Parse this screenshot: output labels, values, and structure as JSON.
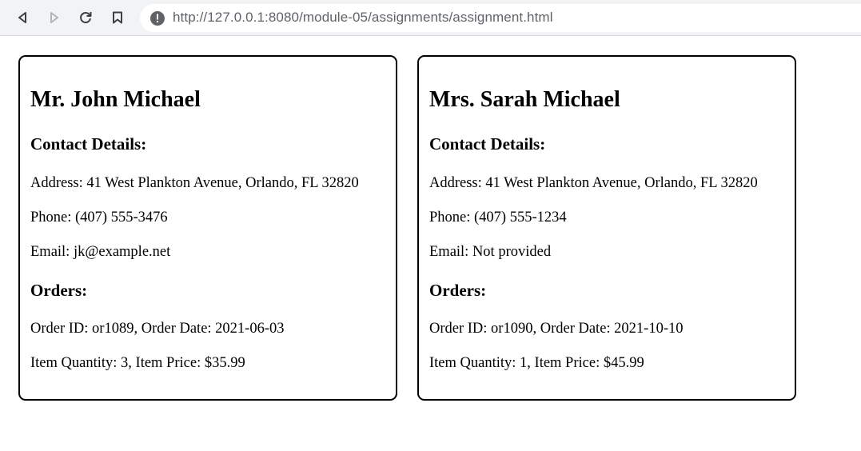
{
  "browser": {
    "url": "http://127.0.0.1:8080/module-05/assignments/assignment.html",
    "buttons": {
      "back": "back-arrow-icon",
      "forward": "forward-arrow-icon",
      "reload": "reload-icon",
      "bookmark": "bookmark-icon"
    },
    "info_icon": "info-icon"
  },
  "customers": [
    {
      "name": "Mr. John Michael",
      "contact_heading": "Contact Details:",
      "address": "Address: 41 West Plankton Avenue, Orlando, FL 32820",
      "phone": "Phone: (407) 555-3476",
      "email": "Email: jk@example.net",
      "orders_heading": "Orders:",
      "order": "Order ID: or1089, Order Date: 2021-06-03",
      "item": "Item Quantity: 3, Item Price: $35.99"
    },
    {
      "name": "Mrs. Sarah Michael",
      "contact_heading": "Contact Details:",
      "address": "Address: 41 West Plankton Avenue, Orlando, FL 32820",
      "phone": "Phone: (407) 555-1234",
      "email": "Email: Not provided",
      "orders_heading": "Orders:",
      "order": "Order ID: or1090, Order Date: 2021-10-10",
      "item": "Item Quantity: 1, Item Price: $45.99"
    }
  ]
}
